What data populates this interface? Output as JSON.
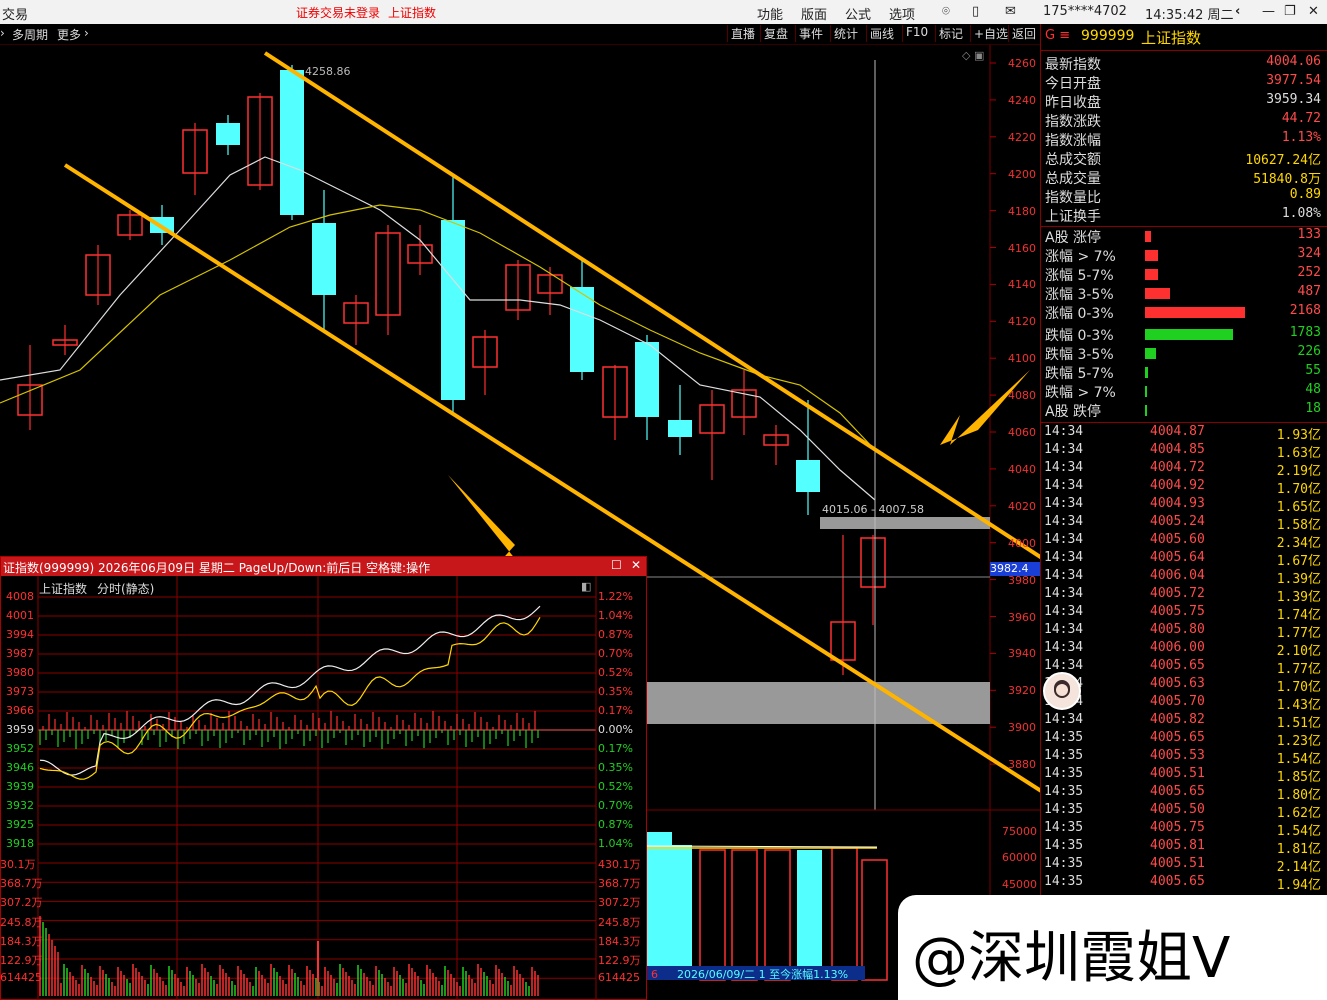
{
  "app": {
    "title_left": "交易",
    "login_status": "证券交易未登录",
    "index_name": "上证指数",
    "menus": [
      "功能",
      "版面",
      "公式",
      "选项"
    ],
    "user": "175****4702",
    "clock": "14:35:42 周二"
  },
  "toolbar": {
    "left": [
      "多周期",
      "更多"
    ],
    "buttons": [
      "直播",
      "复盘",
      "事件",
      "统计",
      "画线",
      "F10",
      "标记",
      "+自选",
      "返回"
    ]
  },
  "main_chart": {
    "y_ticks": [
      "4260",
      "4240",
      "4220",
      "4200",
      "4180",
      "4160",
      "4140",
      "4120",
      "4100",
      "4080",
      "4060",
      "4040",
      "4020",
      "4000",
      "3980",
      "3960",
      "3940",
      "3920",
      "3900",
      "3880"
    ],
    "high_label": "4258.86",
    "range_label": "4015.06 - 4007.58",
    "current_price_box": "3982.4",
    "vol_ticks": [
      "75000",
      "60000",
      "45000"
    ],
    "footer": "2026/06/09/二 1 至今涨幅1.13%",
    "footer_num": "6",
    "colors": {
      "up": "#ff3030",
      "down": "#54ffff",
      "trend": "#ffb400"
    }
  },
  "side_panel": {
    "code": "999999",
    "name": "上证指数",
    "code_prefix": "G ≡",
    "quotes": [
      {
        "label": "最新指数",
        "value": "4004.06",
        "color": "#ff4b4b"
      },
      {
        "label": "今日开盘",
        "value": "3977.54",
        "color": "#ff4b4b"
      },
      {
        "label": "昨日收盘",
        "value": "3959.34",
        "color": "#dddddd"
      },
      {
        "label": "指数涨跌",
        "value": "44.72",
        "color": "#ff4b4b"
      },
      {
        "label": "指数涨幅",
        "value": "1.13%",
        "color": "#ff4b4b"
      },
      {
        "label": "总成交额",
        "value": "10627.24亿",
        "color": "#ffd700"
      },
      {
        "label": "总成交量",
        "value": "51840.8万",
        "color": "#ffd700"
      },
      {
        "label": "指数量比",
        "value": "0.89",
        "color": "#ffd700"
      },
      {
        "label": "上证换手",
        "value": "1.08%",
        "color": "#dddddd"
      }
    ],
    "breadth_up": [
      {
        "label": "A股 涨停",
        "value": "133",
        "bar": 0.05
      },
      {
        "label": "涨幅 > 7%",
        "value": "324",
        "bar": 0.1
      },
      {
        "label": "涨幅 5-7%",
        "value": "252",
        "bar": 0.1
      },
      {
        "label": "涨幅 3-5%",
        "value": "487",
        "bar": 0.2
      },
      {
        "label": "涨幅 0-3%",
        "value": "2168",
        "bar": 0.8
      }
    ],
    "breadth_down": [
      {
        "label": "跌幅 0-3%",
        "value": "1783",
        "bar": 0.7
      },
      {
        "label": "跌幅 3-5%",
        "value": "226",
        "bar": 0.09
      },
      {
        "label": "跌幅 5-7%",
        "value": "55",
        "bar": 0.02
      },
      {
        "label": "跌幅 > 7%",
        "value": "48",
        "bar": 0.015
      },
      {
        "label": "A股 跌停",
        "value": "18",
        "bar": 0.008
      }
    ],
    "ticks": [
      {
        "t": "14:34",
        "p": "4004.87",
        "v": "1.93亿"
      },
      {
        "t": "14:34",
        "p": "4004.85",
        "v": "1.63亿"
      },
      {
        "t": "14:34",
        "p": "4004.72",
        "v": "2.19亿"
      },
      {
        "t": "14:34",
        "p": "4004.92",
        "v": "1.70亿"
      },
      {
        "t": "14:34",
        "p": "4004.93",
        "v": "1.65亿"
      },
      {
        "t": "14:34",
        "p": "4005.24",
        "v": "1.58亿"
      },
      {
        "t": "14:34",
        "p": "4005.60",
        "v": "2.34亿"
      },
      {
        "t": "14:34",
        "p": "4005.64",
        "v": "1.67亿"
      },
      {
        "t": "14:34",
        "p": "4006.04",
        "v": "1.39亿"
      },
      {
        "t": "14:34",
        "p": "4005.72",
        "v": "1.39亿"
      },
      {
        "t": "14:34",
        "p": "4005.75",
        "v": "1.74亿"
      },
      {
        "t": "14:34",
        "p": "4005.80",
        "v": "1.77亿"
      },
      {
        "t": "14:34",
        "p": "4006.00",
        "v": "2.10亿"
      },
      {
        "t": "14:34",
        "p": "4005.65",
        "v": "1.77亿"
      },
      {
        "t": "14:34",
        "p": "4005.63",
        "v": "1.70亿"
      },
      {
        "t": "14:34",
        "p": "4005.70",
        "v": "1.43亿"
      },
      {
        "t": "14:34",
        "p": "4005.82",
        "v": "1.51亿"
      },
      {
        "t": "14:35",
        "p": "4005.65",
        "v": "1.23亿"
      },
      {
        "t": "14:35",
        "p": "4005.53",
        "v": "1.54亿"
      },
      {
        "t": "14:35",
        "p": "4005.51",
        "v": "1.85亿"
      },
      {
        "t": "14:35",
        "p": "4005.65",
        "v": "1.80亿"
      },
      {
        "t": "14:35",
        "p": "4005.50",
        "v": "1.62亿"
      },
      {
        "t": "14:35",
        "p": "4005.75",
        "v": "1.54亿"
      },
      {
        "t": "14:35",
        "p": "4005.81",
        "v": "1.81亿"
      },
      {
        "t": "14:35",
        "p": "4005.51",
        "v": "2.14亿"
      },
      {
        "t": "14:35",
        "p": "4005.65",
        "v": "1.94亿"
      }
    ]
  },
  "intraday": {
    "title": "证指数(999999) 2026年06月09日 星期二 PageUp/Down:前后日 空格键:操作",
    "sub_title": "上证指数",
    "sub_mode": "分时(静态)",
    "price_ticks": [
      "4008",
      "4001",
      "3994",
      "3987",
      "3980",
      "3973",
      "3966",
      "3959",
      "3952",
      "3946",
      "3939",
      "3932",
      "3925",
      "3918"
    ],
    "pct_ticks": [
      "1.22%",
      "1.04%",
      "0.87%",
      "0.70%",
      "0.52%",
      "0.35%",
      "0.17%",
      "0.00%",
      "0.17%",
      "0.35%",
      "0.52%",
      "0.70%",
      "0.87%",
      "1.04%"
    ],
    "vol_ticks_left": [
      "30.1万",
      "368.7万",
      "307.2万",
      "245.8万",
      "184.3万",
      "122.9万",
      "614425"
    ],
    "vol_ticks_right": [
      "430.1万",
      "368.7万",
      "307.2万",
      "245.8万",
      "184.3万",
      "122.9万",
      "614425"
    ]
  },
  "watermark": "@深圳霞姐V"
}
